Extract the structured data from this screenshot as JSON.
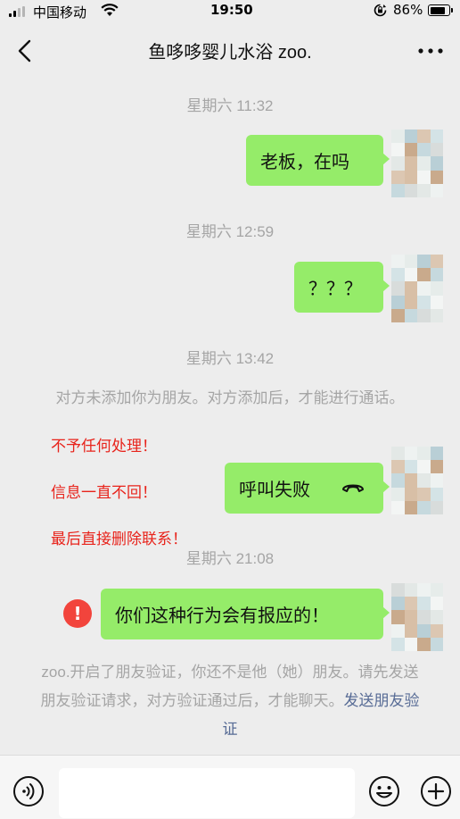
{
  "status_bar": {
    "carrier": "中国移动",
    "time": "19:50",
    "battery_percent": "86%",
    "battery_level": 0.86,
    "icons": [
      "signal-icon",
      "wifi-icon",
      "orientation-lock-icon",
      "battery-icon"
    ]
  },
  "nav": {
    "title": "鱼哆哆婴儿水浴 zoo.",
    "icons": [
      "back-icon",
      "more-icon"
    ]
  },
  "messages": {
    "t1": "星期六 11:32",
    "m1": "老板，在吗",
    "t2": "星期六 12:59",
    "m2": "？？？",
    "t3": "星期六 13:42",
    "system1": "对方未添加你为朋友。对方添加后，才能进行通话。",
    "call": "呼叫失败",
    "t4": "星期六 21:08",
    "m4": "你们这种行为会有报应的！",
    "m4_status": "!",
    "system2": "zoo.开启了朋友验证，你还不是他（她）朋友。请先发送朋友验证请求，对方验证通过后，才能聊天。",
    "system2_link": "发送朋友验证"
  },
  "annotations": {
    "a1": "不予任何处理！",
    "a2": "信息一直不回！",
    "a3": "最后直接删除联系！",
    "color": "#e8231b"
  },
  "colors": {
    "bubble": "#95ec69",
    "background": "#ededed",
    "link": "#576b95",
    "error": "#f2443c"
  },
  "input_bar": {
    "placeholder": "",
    "icons": [
      "voice-icon",
      "emoji-icon",
      "plus-icon"
    ]
  }
}
